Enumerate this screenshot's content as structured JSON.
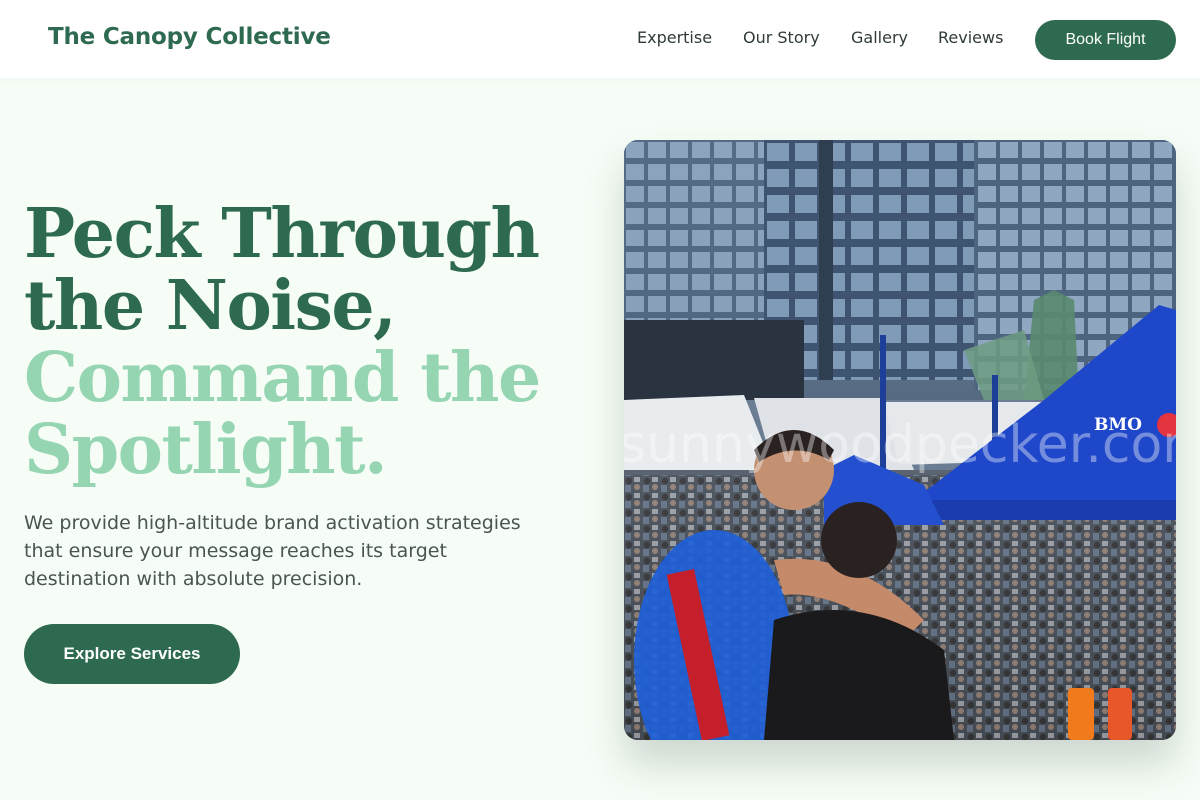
{
  "brand": {
    "name": "The Canopy Collective"
  },
  "nav": {
    "links": [
      "Expertise",
      "Our Story",
      "Gallery",
      "Reviews"
    ],
    "cta_label": "Book Flight"
  },
  "hero": {
    "headline_dark": [
      "Peck Through",
      "the Noise,"
    ],
    "headline_light": [
      "Command the",
      "Spotlight."
    ],
    "subtitle": "We provide high-altitude brand activation strategies that ensure your message reaches its target destination with absolute precision.",
    "cta_label": "Explore Services"
  },
  "photo": {
    "tent_text": "BMO",
    "watermark": "sunnywoodpecker.com"
  },
  "colors": {
    "accent": "#2d6a4f",
    "accent_light": "#95d5b2",
    "background": "#f6fdf6",
    "text_muted": "#4a5550"
  }
}
